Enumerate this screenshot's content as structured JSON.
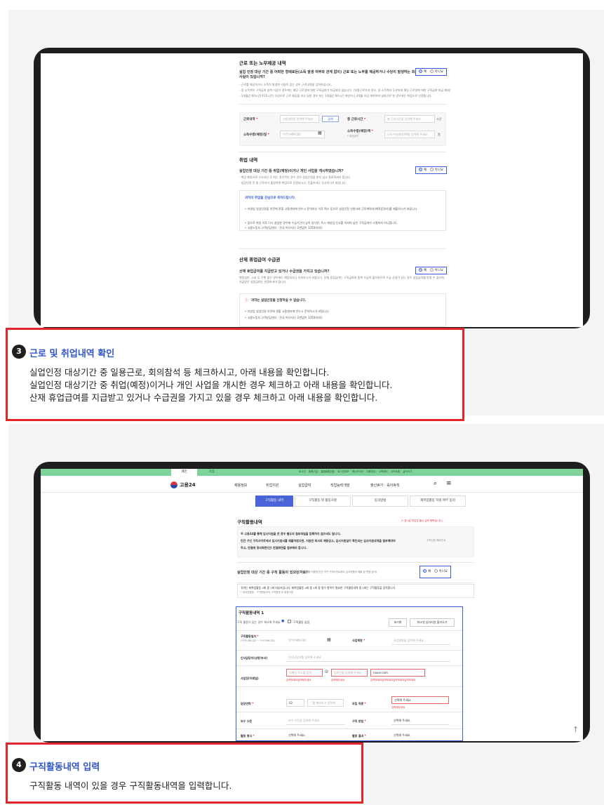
{
  "section1": {
    "title": "근로 또는 노무제공 내역",
    "question": "실업 인정 대상 기간 중 어떠한 형태로든(소득 발생 여부와 관계 없이) 근로 또는 노무를 제공하거나 수당이 발생하는 회의 참석, 자문 활동 등 사실이 있습니까?",
    "notes": [
      "- 근로를 제공하거나 소득이 발생한 사실이 있는 경우 근로내역을 입력하십시오.",
      "- 일 소득액이 구직급여 일액 이상인 경우에는 해당 근로일에 대한 구직급여가 지급되지 않습니다. (일용근로자의 경우, 일 소득액과 무관하게 해당 근로일에 대한 구직급여 지급 제외)",
      "- 1개월간 60시간(주15시간) 이상으로 근로 제공을 하고 일한 경우 또는 1개월간 60시간 미만이나 3개월 이상 계속하여 일하기로 한 경우에는 취업으로 인정됩니다."
    ],
    "radio_yes": "예",
    "radio_no": "아니요",
    "work_type_label": "근로내역",
    "work_type_placeholder": "고용내역을 입력해 주세요",
    "search_btn": "검색",
    "total_hours_label": "총 근로시간",
    "total_hours_placeholder": "총 근로시간을 입력해 주세요",
    "hours_unit": "시간",
    "income_date_label": "소득수령(예정)일",
    "income_date_placeholder": "YYYY-MM-DD",
    "income_amount_label": "소득수령(예정)액",
    "income_amount_note": "* 세전금액",
    "income_amount_placeholder": "소득수령(예정)액을 입력해 주세요",
    "won_unit": "원"
  },
  "section2": {
    "title": "취업 내역",
    "question": "실업인정 대상 기간 중 취업(예정)이거나 개인 사업을 개시하였습니까?",
    "notes": [
      "- 취업 예정으로 신고하신 후 최는 정기적인 경우 경우 실업인정을 받지 않고 종료하셔야 합니다.",
      "- 실업인정 전 중 근로자가 출장하면 취업으로 인정되시고, 진출하셔도 신고하시기 바랍니다."
    ],
    "radio_yes": "예",
    "radio_no": "아니요",
    "info_title": "귀하의 취업을 진심으로 축하드립니다.",
    "info_lines": [
      "• 자영업 실업인정을 이전에 관할 고용센터에 반드시 문의하신 이후 팩스 등으로 실업인정 신청서와 근로계약서(재직증명서)를 제출하시기 바랍니다.",
      "• 앞으로 취업 이후 다시 실업한 경우에 수급기간이 남아 있다면, 즉시 재실업 신고를 하셔야 남은 구직급여가 소멸되지 아니합니다.",
      "• 고용노동부 고객상담센터 : 전국 어디서나 국번없이 1350(유료)"
    ]
  },
  "section3": {
    "title": "산재 휴업급여 수급권",
    "question": "산재 휴업급여를 지급받고 있거나 수급권을 가지고 있습니까?",
    "note": "행정심판, 소송 등 진행 중인 경우에도 해당되오니 유의하시기 바랍니다. 산재 휴업급여는 구직급여와 중복 수급이 불가하므로 수급 사실이 있는 경우 실업급여를 받을 수 없으며, 지급받은 실업급여는 반환하셔야 합니다.",
    "radio_yes": "예",
    "radio_no": "아니요",
    "warn_title": "귀하는 실업인정을 신청하실 수 없습니다.",
    "warn_lines": [
      "• 자영업 실업인정 이전에 관할 고용센터에 반드시 문의하시기 바랍니다.",
      "• 고용노동부 고객상담센터 : 전국 어디서나 국번없이 1350(유료)"
    ]
  },
  "callout3": {
    "number": "3",
    "title": "근로 및 취업내역 확인",
    "lines": [
      "실업인정 대상기간 중 일용근로, 회의참석 등 체크하시고, 아래 내용을 확인합니다.",
      "실업인정 대상기간 중 취업(예정)이거나 개인 사업을 개시한 경우 체크하고 아래 내용을 확인합니다.",
      "산재 휴업급여를 지급받고 있거나 수급권을 가지고 있을 경우 체크하고 아래 내용을 확인합니다."
    ]
  },
  "site": {
    "top_tabs": [
      "개인",
      "기업"
    ],
    "top_links": [
      "로그인",
      "회원가입",
      "통합회원전환",
      "로그인정보",
      "에이자이지",
      "이용안내",
      "고객센터",
      "사이트맵",
      "글자크기"
    ],
    "logo": "고용24",
    "gnb": [
      "채용정보",
      "취업지원",
      "실업급여",
      "직업능력개발",
      "출산휴가 · 육아휴직"
    ],
    "tabs": [
      "구직활동 내역",
      "구직활동 외 활동사항",
      "동의방법",
      "재취업활동 지원 여부 동의"
    ],
    "page_title": "구직활동내역",
    "required_note": "(* 표시된 부분은 필수 입력 항목입니다.)",
    "notice_lines": [
      "※ 고용24를 통해 입사지원을 한 경우 별도의 첨부파일을 등록하지 않으셔도 됩니다.",
      "민간 구인 구직사이트에서 입사지원서를 제출하였다면, 지원한 회사의 채용공고, 입사지원일이 확인되는 입사지원내역을 첨부해야야",
      "하고, 반절에 증서화면(단) 된절화면을 첨부해야 합니다."
    ],
    "notice_side": "구직신청 예비안내",
    "question": "실업인정 대상 기간 중 구직 활동이 있으신가요?",
    "question_note": "(예 : 고용24를 이용한 민간 구인 구직사이트에서 입사지원서 제출 및 면접 참석)",
    "radio_yes": "예",
    "radio_no": "아니요",
    "info_line1": "귀하는 재취업활동 4회 중 1회 대상자입니다. 재취업활동 4회 중 1회 중 필수 항목이 필요한 구직활동내역 중 1회는 구직활동을 입력합니다.",
    "info_line2": "* 재취업활동 : 구직활동내역, 구직활동 외 활동사항",
    "form_title": "구직활동내역 1",
    "form_hint": "구직 활동이 없는 경우 체크해 주세요",
    "no_activity": "구직활동 없음",
    "reset_btn": "초기화",
    "load_btn": "워크넷 입사지원 불러오기",
    "f_date_label": "구직활동일자",
    "f_date_sub": "(YYYY-MM-DD) ~ YYYY-MM-DD)",
    "f_date_ph": "YYYY-MM-DD",
    "f_company_label": "사업체명",
    "f_company_ph": "사업체명을 입력해 주세요",
    "f_manager_label": "인사담당자(성명/부서)",
    "f_manager_ph": "인사담당자를 입력해 주세요",
    "f_email_label": "사업장(이메일)",
    "f_email_ph1": "이메일 주소를 입력",
    "f_email_ph2": "입력란을 입력해 주세요",
    "f_email_domain": "naver.com",
    "f_email_err1": "입력하세요입력해주세요",
    "f_email_err2": "입력해주세요",
    "f_email_err3": "입력하세요입력하세요입력하세요입력하세요",
    "f_phone_label": "담당연락",
    "f_phone_prefix": "02",
    "f_phone_ph": "'-'를 제외하고 입력해",
    "f_type_label": "모집 직종",
    "f_type_ph": "선택해 주세요.",
    "f_type_err": "입력해주세요",
    "f_pay_label": "보수 수준",
    "f_pay_ph": "보수 수준을 입력해 주세요",
    "f_method_label": "구직 방법",
    "f_method_ph": "선택해 주세요.",
    "f_form_label": "활동 형식",
    "f_form_ph": "선택해 주세요.",
    "f_result_label": "활동 결과",
    "f_result_ph": "선택해 주세요."
  },
  "callout4": {
    "number": "4",
    "title": "구직활동내역 입력",
    "line": "구직활동 내역이 있을 경우 구직활동내역을 입력합니다."
  },
  "scroll_top": "↑"
}
